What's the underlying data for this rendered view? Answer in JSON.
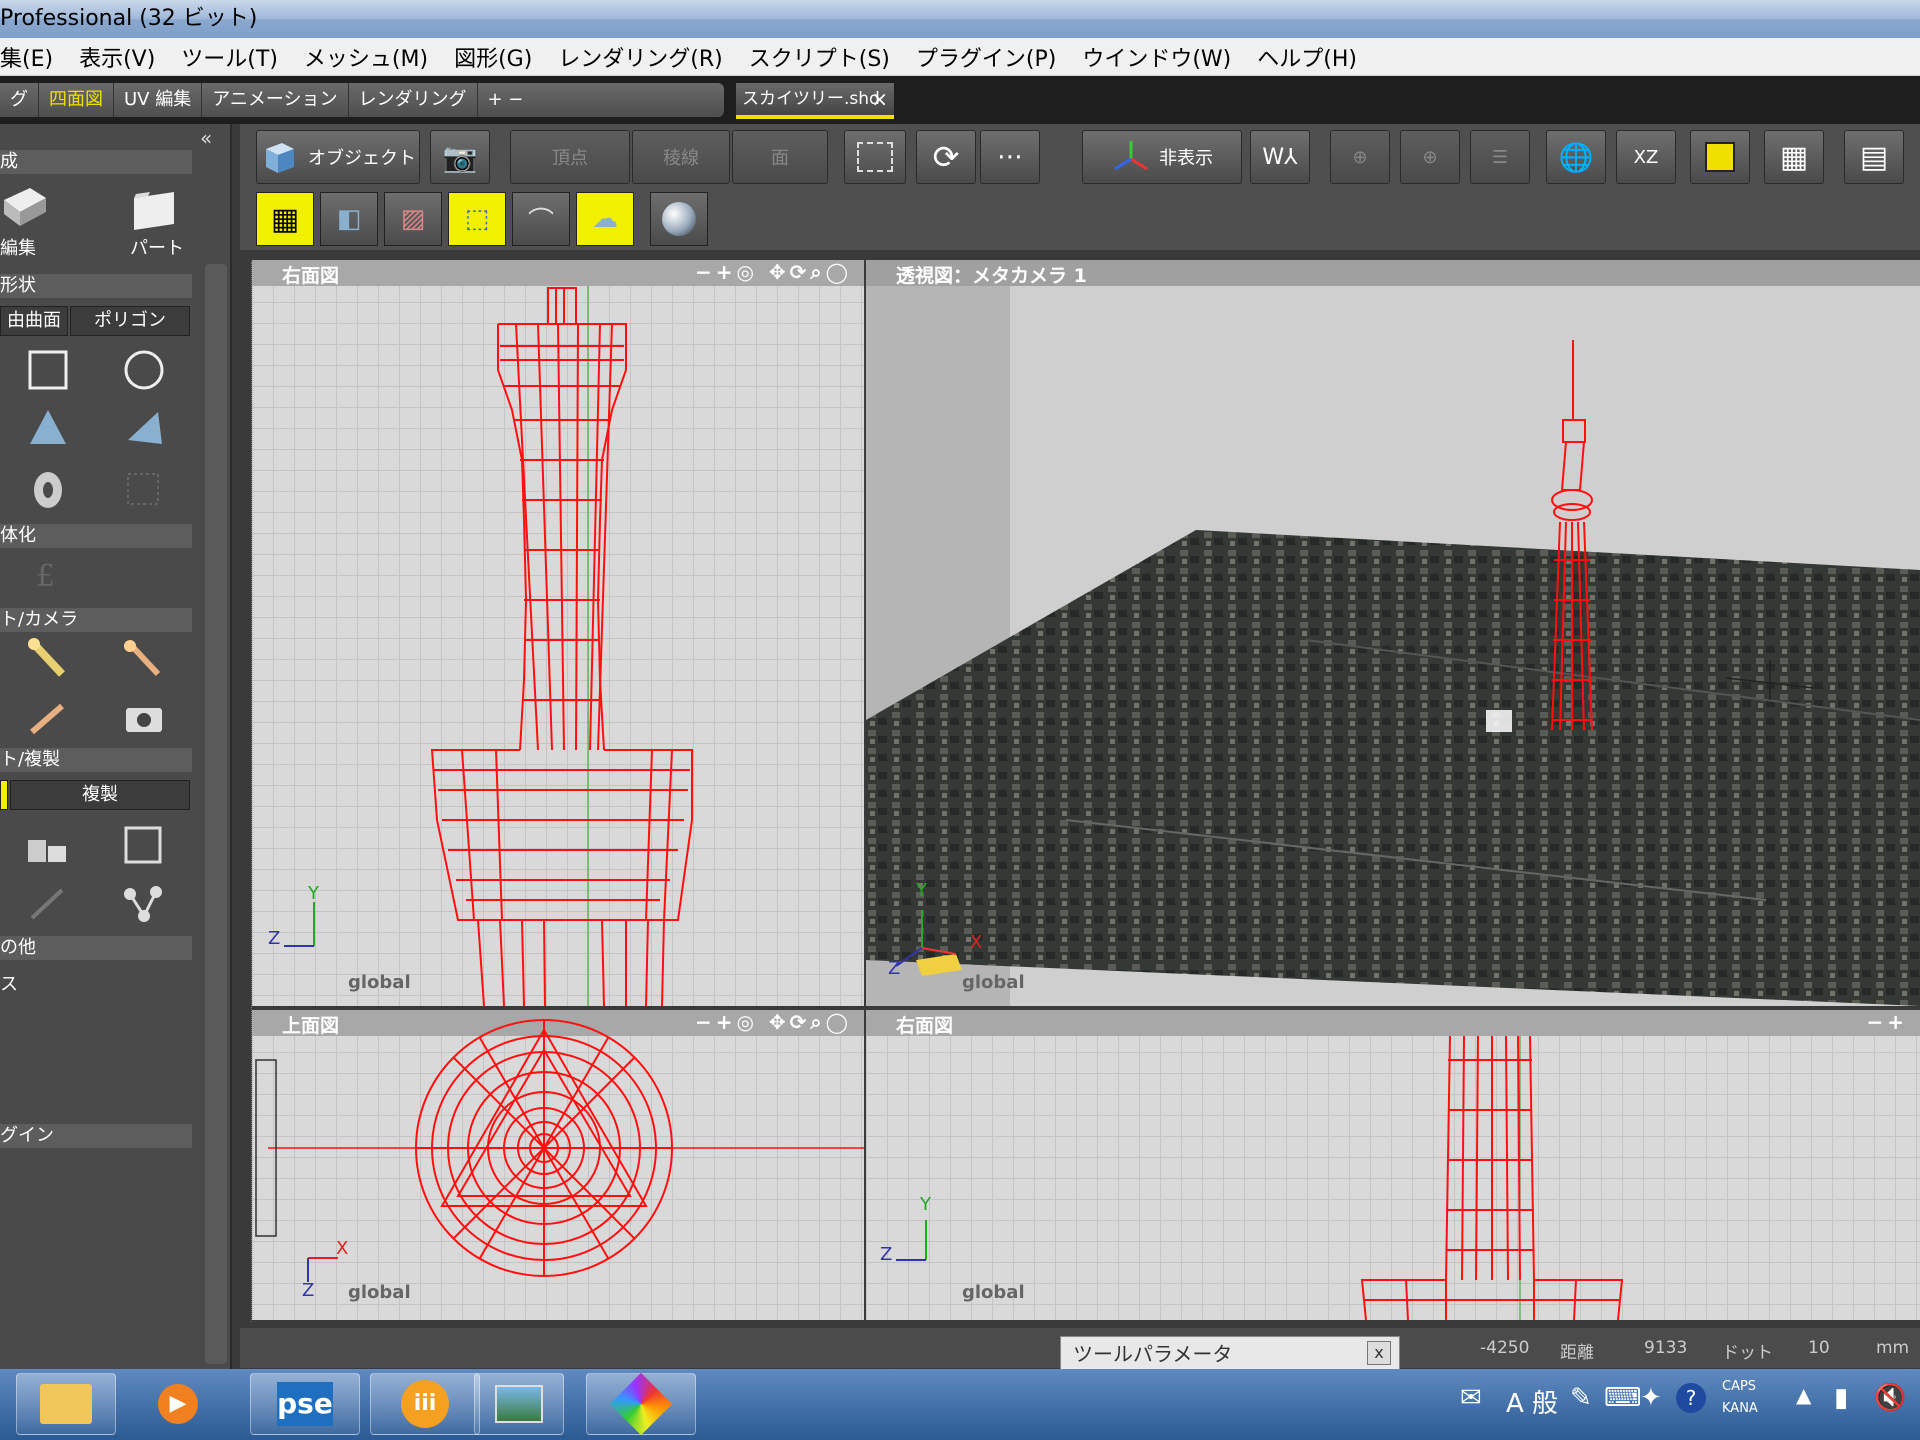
{
  "window": {
    "title": "Professional (32 ビット)"
  },
  "menu": [
    "集(E)",
    "表示(V)",
    "ツール(T)",
    "メッシュ(M)",
    "図形(G)",
    "レンダリング(R)",
    "スクリプト(S)",
    "プラグイン(P)",
    "ウインドウ(W)",
    "ヘルプ(H)"
  ],
  "mode_tabs": [
    "グ",
    "四面図",
    "UV 編集",
    "アニメーション",
    "レンダリング",
    "+ −"
  ],
  "active_mode_tab": "四面図",
  "document_tab": {
    "label": "スカイツリー.shd",
    "close": "×"
  },
  "left_panel": {
    "collapse": "«",
    "section_create": "成",
    "btn_edit": "編集",
    "btn_part": "パート",
    "section_shape": "形状",
    "btn_curve": "由曲面",
    "btn_polygon": "ポリゴン",
    "section_solid": "体化",
    "section_light": "ト/カメラ",
    "section_copy": "ト/複製",
    "btn_copy": "複製",
    "section_other": "の他",
    "item_s": "ス",
    "section_plugin": "グイン"
  },
  "toolbar": {
    "object": "オブジェクト",
    "vertex": "頂点",
    "edge": "稜線",
    "face": "面",
    "hide": "非表示",
    "xz": "XZ"
  },
  "viewports": {
    "top_left": {
      "title": "右面図",
      "controls": "−+◎ ✥⟳⌕◯",
      "axis_y": "Y",
      "axis_z": "Z",
      "global": "global"
    },
    "top_right": {
      "title": "透視図：メタカメラ 1",
      "axis_y": "Y",
      "axis_x": "X",
      "axis_z": "Z",
      "global": "global"
    },
    "bottom_left": {
      "title": "上面図",
      "controls": "−+◎ ✥⟳⌕◯",
      "axis_x": "X",
      "axis_z": "Z",
      "global": "global"
    },
    "bottom_right": {
      "title": "右面図",
      "controls": "−+",
      "axis_y": "Y",
      "axis_z": "Z",
      "global": "global"
    }
  },
  "status": {
    "coord": "-4250",
    "distance_label": "距離",
    "distance_value": "9133",
    "unit_label": "ドット",
    "dot_value": "10",
    "unit": "mm"
  },
  "tool_parameter": {
    "title": "ツールパラメータ",
    "close": "x"
  },
  "taskbar": {
    "apps": [
      "explorer",
      "media-player",
      "pse",
      "iii",
      "photo-viewer",
      "shade"
    ],
    "pse_label": "pse",
    "tray_caps": "CAPS",
    "tray_kana": "KANA",
    "tray_ime": "A 般"
  },
  "colors": {
    "wire": "#ff1010",
    "accent": "#f0e000"
  }
}
